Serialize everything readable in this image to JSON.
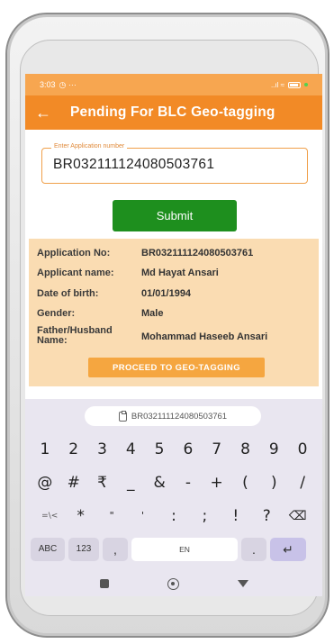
{
  "status_bar": {
    "time": "3:03",
    "left_icons": "◷ ···",
    "right_icons": "..ıl ≈"
  },
  "app_bar": {
    "back_glyph": "←",
    "title": "Pending For BLC Geo-tagging"
  },
  "application_input": {
    "label": "Enter Application number",
    "value": "BR032111124080503761"
  },
  "submit_label": "Submit",
  "details": {
    "rows": [
      {
        "label": "Application No:",
        "value": "BR032111124080503761"
      },
      {
        "label": "Applicant name:",
        "value": "Md Hayat Ansari"
      },
      {
        "label": "Date of birth:",
        "value": "01/01/1994"
      },
      {
        "label": "Gender:",
        "value": "Male"
      },
      {
        "label": "Father/Husband Name:",
        "value": "Mohammad Haseeb Ansari"
      }
    ],
    "proceed_label": "PROCEED TO GEO-TAGGING"
  },
  "keyboard": {
    "suggestion": "BR032111124080503761",
    "row1": [
      "1",
      "2",
      "3",
      "4",
      "5",
      "6",
      "7",
      "8",
      "9",
      "0"
    ],
    "row2": [
      "@",
      "#",
      "₹",
      "_",
      "&",
      "-",
      "+",
      "(",
      ")",
      "/"
    ],
    "row3": [
      "=\\<",
      "*",
      "\"",
      "'",
      ":",
      ";",
      "!",
      "?",
      "⌫"
    ],
    "row4": {
      "abc": "ABC",
      "num": "123",
      "comma": ",",
      "space": "EN",
      "period": ".",
      "enter": "↵"
    }
  },
  "colors": {
    "app_bar": "#f28a26",
    "status_bar": "#f7a650",
    "submit": "#1e8f1e",
    "details_bg": "#fadcb2",
    "proceed": "#f5a640"
  }
}
